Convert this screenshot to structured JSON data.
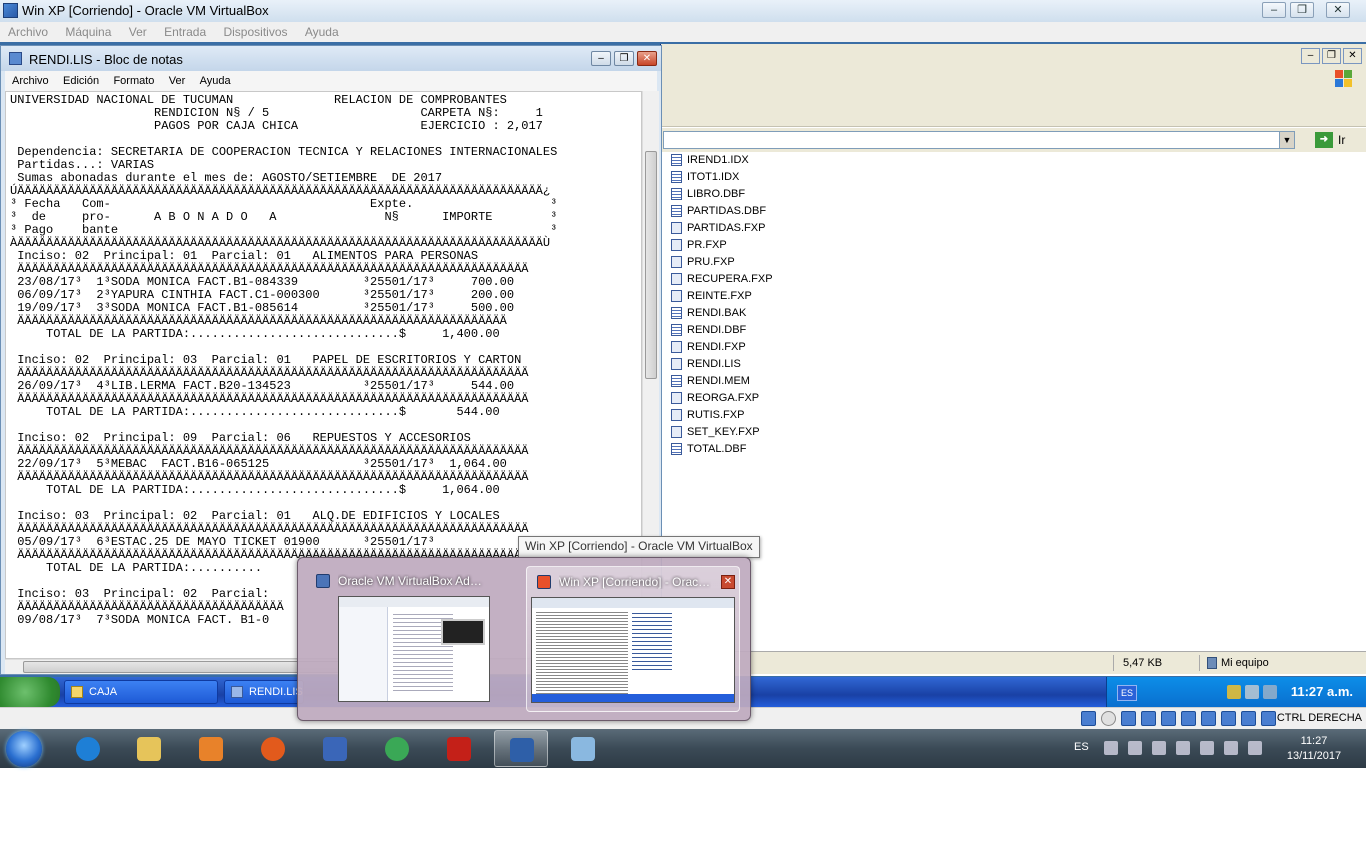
{
  "vb_window": {
    "title": "Win XP [Corriendo] - Oracle VM VirtualBox",
    "menu": [
      "Archivo",
      "Máquina",
      "Ver",
      "Entrada",
      "Dispositivos",
      "Ayuda"
    ],
    "status_right": "CTRL DERECHA"
  },
  "notepad": {
    "title": "RENDI.LIS - Bloc de notas",
    "menu": [
      "Archivo",
      "Edición",
      "Formato",
      "Ver",
      "Ayuda"
    ],
    "lines": [
      "UNIVERSIDAD NACIONAL DE TUCUMAN              RELACION DE COMPROBANTES",
      "                    RENDICION N§ / 5                     CARPETA N§:     1",
      "                    PAGOS POR CAJA CHICA                 EJERCICIO : 2,017",
      "",
      " Dependencia: SECRETARIA DE COOPERACION TECNICA Y RELACIONES INTERNACIONALES",
      " Partidas...: VARIAS",
      " Sumas abonadas durante el mes de: AGOSTO/SETIEMBRE  DE 2017",
      "ÚÄÄÄÄÄÄÄÄÄÄÄÄÄÄÄÄÄÄÄÄÄÄÄÄÄÄÄÄÄÄÄÄÄÄÄÄÄÄÄÄÄÄÄÄÄÄÄÄÄÄÄÄÄÄÄÄÄÄÄÄÄÄÄÄÄÄÄÄÄÄÄÄÄ¿",
      "³ Fecha   Com-                                    Expte.                   ³",
      "³  de     pro-      A B O N A D O   A               N§      IMPORTE        ³",
      "³ Pago    bante                                                            ³",
      "ÀÄÄÄÄÄÄÄÄÄÄÄÄÄÄÄÄÄÄÄÄÄÄÄÄÄÄÄÄÄÄÄÄÄÄÄÄÄÄÄÄÄÄÄÄÄÄÄÄÄÄÄÄÄÄÄÄÄÄÄÄÄÄÄÄÄÄÄÄÄÄÄÄÄÙ",
      " Inciso: 02  Principal: 01  Parcial: 01   ALIMENTOS PARA PERSONAS",
      " ÄÄÄÄÄÄÄÄÄÄÄÄÄÄÄÄÄÄÄÄÄÄÄÄÄÄÄÄÄÄÄÄÄÄÄÄÄÄÄÄÄÄÄÄÄÄÄÄÄÄÄÄÄÄÄÄÄÄÄÄÄÄÄÄÄÄÄÄÄÄÄ",
      " 23/08/17³  1³SODA MONICA FACT.B1-084339         ³25501/17³     700.00",
      " 06/09/17³  2³YAPURA CINTHIA FACT.C1-000300      ³25501/17³     200.00",
      " 19/09/17³  3³SODA MONICA FACT.B1-085614         ³25501/17³     500.00",
      " ÄÄÄÄÄÄÄÄÄÄÄÄÄÄÄÄÄÄÄÄÄÄÄÄÄÄÄÄÄÄÄÄÄÄÄÄÄÄÄÄÄÄÄÄÄÄÄÄÄÄÄÄÄÄÄÄÄÄÄÄÄÄÄÄÄÄÄÄ",
      "     TOTAL DE LA PARTIDA:.............................$     1,400.00",
      "",
      " Inciso: 02  Principal: 03  Parcial: 01   PAPEL DE ESCRITORIOS Y CARTON",
      " ÄÄÄÄÄÄÄÄÄÄÄÄÄÄÄÄÄÄÄÄÄÄÄÄÄÄÄÄÄÄÄÄÄÄÄÄÄÄÄÄÄÄÄÄÄÄÄÄÄÄÄÄÄÄÄÄÄÄÄÄÄÄÄÄÄÄÄÄÄÄÄ",
      " 26/09/17³  4³LIB.LERMA FACT.B20-134523          ³25501/17³     544.00",
      " ÄÄÄÄÄÄÄÄÄÄÄÄÄÄÄÄÄÄÄÄÄÄÄÄÄÄÄÄÄÄÄÄÄÄÄÄÄÄÄÄÄÄÄÄÄÄÄÄÄÄÄÄÄÄÄÄÄÄÄÄÄÄÄÄÄÄÄÄÄÄÄ",
      "     TOTAL DE LA PARTIDA:.............................$       544.00",
      "",
      " Inciso: 02  Principal: 09  Parcial: 06   REPUESTOS Y ACCESORIOS",
      " ÄÄÄÄÄÄÄÄÄÄÄÄÄÄÄÄÄÄÄÄÄÄÄÄÄÄÄÄÄÄÄÄÄÄÄÄÄÄÄÄÄÄÄÄÄÄÄÄÄÄÄÄÄÄÄÄÄÄÄÄÄÄÄÄÄÄÄÄÄÄÄ",
      " 22/09/17³  5³MEBAC  FACT.B16-065125             ³25501/17³  1,064.00",
      " ÄÄÄÄÄÄÄÄÄÄÄÄÄÄÄÄÄÄÄÄÄÄÄÄÄÄÄÄÄÄÄÄÄÄÄÄÄÄÄÄÄÄÄÄÄÄÄÄÄÄÄÄÄÄÄÄÄÄÄÄÄÄÄÄÄÄÄÄÄÄÄ",
      "     TOTAL DE LA PARTIDA:.............................$     1,064.00",
      "",
      " Inciso: 03  Principal: 02  Parcial: 01   ALQ.DE EDIFICIOS Y LOCALES",
      " ÄÄÄÄÄÄÄÄÄÄÄÄÄÄÄÄÄÄÄÄÄÄÄÄÄÄÄÄÄÄÄÄÄÄÄÄÄÄÄÄÄÄÄÄÄÄÄÄÄÄÄÄÄÄÄÄÄÄÄÄÄÄÄÄÄÄÄÄÄÄÄ",
      " 05/09/17³  6³ESTAC.25 DE MAYO TICKET 01900      ³25501/17³",
      " ÄÄÄÄÄÄÄÄÄÄÄÄÄÄÄÄÄÄÄÄÄÄÄÄÄÄÄÄÄÄÄÄÄÄÄÄÄÄÄÄÄÄÄÄÄÄÄÄÄÄÄÄÄÄÄÄÄÄÄÄÄÄÄÄÄÄÄÄÄÄÄ",
      "     TOTAL DE LA PARTIDA:..........",
      "",
      " Inciso: 03  Principal: 02  Parcial: ",
      " ÄÄÄÄÄÄÄÄÄÄÄÄÄÄÄÄÄÄÄÄÄÄÄÄÄÄÄÄÄÄÄÄÄÄÄÄÄ",
      " 09/08/17³  7³SODA MONICA FACT. B1-0"
    ]
  },
  "explorer": {
    "go_label": "Ir",
    "files": [
      {
        "name": "IREND1.IDX",
        "kind": "db"
      },
      {
        "name": "ITOT1.IDX",
        "kind": "db"
      },
      {
        "name": "LIBRO.DBF",
        "kind": "db"
      },
      {
        "name": "PARTIDAS.DBF",
        "kind": "db"
      },
      {
        "name": "PARTIDAS.FXP",
        "kind": "doc"
      },
      {
        "name": "PR.FXP",
        "kind": "doc"
      },
      {
        "name": "PRU.FXP",
        "kind": "doc"
      },
      {
        "name": "RECUPERA.FXP",
        "kind": "doc"
      },
      {
        "name": "REINTE.FXP",
        "kind": "doc"
      },
      {
        "name": "RENDI.BAK",
        "kind": "db"
      },
      {
        "name": "RENDI.DBF",
        "kind": "db"
      },
      {
        "name": "RENDI.FXP",
        "kind": "doc"
      },
      {
        "name": "RENDI.LIS",
        "kind": "doc"
      },
      {
        "name": "RENDI.MEM",
        "kind": "db"
      },
      {
        "name": "REORGA.FXP",
        "kind": "doc"
      },
      {
        "name": "RUTIS.FXP",
        "kind": "doc"
      },
      {
        "name": "SET_KEY.FXP",
        "kind": "doc"
      },
      {
        "name": "TOTAL.DBF",
        "kind": "db"
      }
    ],
    "status_size": "5,47 KB",
    "status_location": "Mi equipo"
  },
  "xp_taskbar": {
    "tasks": [
      {
        "label": "CAJA"
      },
      {
        "label": "RENDI.LIS"
      }
    ],
    "lang": "ES",
    "clock": "11:27 a.m."
  },
  "preview": {
    "tooltip": "Win XP [Corriendo] - Oracle VM VirtualBox",
    "thumbs": [
      {
        "label": "Oracle VM VirtualBox Administr..."
      },
      {
        "label": "Win XP [Corriendo] - Oracle ..."
      }
    ]
  },
  "win7_taskbar": {
    "lang": "ES",
    "time": "11:27",
    "date": "13/11/2017",
    "apps": [
      {
        "name": "internet-explorer-icon",
        "color": "#1e7fd6"
      },
      {
        "name": "file-explorer-icon",
        "color": "#e6c45a"
      },
      {
        "name": "media-player-icon",
        "color": "#e8822a"
      },
      {
        "name": "firefox-icon",
        "color": "#e25a1c"
      },
      {
        "name": "thunderbird-icon",
        "color": "#3a66b8"
      },
      {
        "name": "chrome-icon",
        "color": "#3aa856"
      },
      {
        "name": "acrobat-reader-icon",
        "color": "#c42018"
      },
      {
        "name": "virtualbox-icon",
        "color": "#2e5fa8"
      },
      {
        "name": "paint-icon",
        "color": "#8ab8e0"
      }
    ]
  }
}
